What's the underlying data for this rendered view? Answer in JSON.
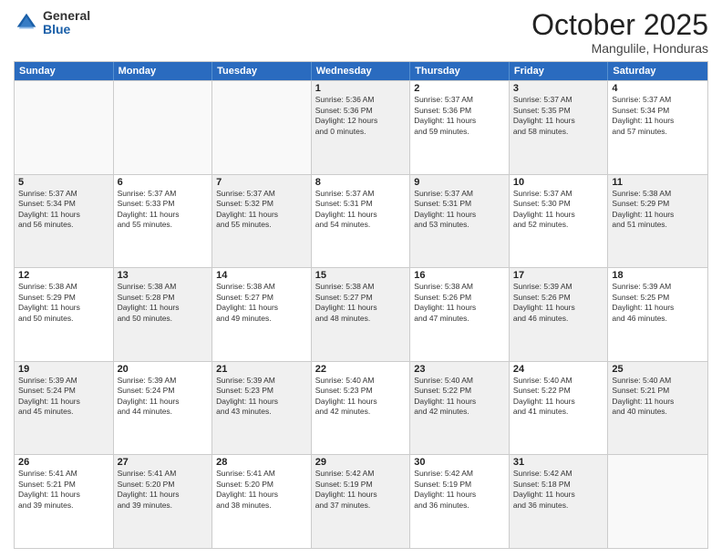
{
  "logo": {
    "general": "General",
    "blue": "Blue"
  },
  "title": "October 2025",
  "location": "Mangulile, Honduras",
  "header_days": [
    "Sunday",
    "Monday",
    "Tuesday",
    "Wednesday",
    "Thursday",
    "Friday",
    "Saturday"
  ],
  "rows": [
    [
      {
        "day": "",
        "info": "",
        "empty": true
      },
      {
        "day": "",
        "info": "",
        "empty": true
      },
      {
        "day": "",
        "info": "",
        "empty": true
      },
      {
        "day": "1",
        "info": "Sunrise: 5:36 AM\nSunset: 5:36 PM\nDaylight: 12 hours\nand 0 minutes."
      },
      {
        "day": "2",
        "info": "Sunrise: 5:37 AM\nSunset: 5:36 PM\nDaylight: 11 hours\nand 59 minutes."
      },
      {
        "day": "3",
        "info": "Sunrise: 5:37 AM\nSunset: 5:35 PM\nDaylight: 11 hours\nand 58 minutes."
      },
      {
        "day": "4",
        "info": "Sunrise: 5:37 AM\nSunset: 5:34 PM\nDaylight: 11 hours\nand 57 minutes."
      }
    ],
    [
      {
        "day": "5",
        "info": "Sunrise: 5:37 AM\nSunset: 5:34 PM\nDaylight: 11 hours\nand 56 minutes."
      },
      {
        "day": "6",
        "info": "Sunrise: 5:37 AM\nSunset: 5:33 PM\nDaylight: 11 hours\nand 55 minutes."
      },
      {
        "day": "7",
        "info": "Sunrise: 5:37 AM\nSunset: 5:32 PM\nDaylight: 11 hours\nand 55 minutes."
      },
      {
        "day": "8",
        "info": "Sunrise: 5:37 AM\nSunset: 5:31 PM\nDaylight: 11 hours\nand 54 minutes."
      },
      {
        "day": "9",
        "info": "Sunrise: 5:37 AM\nSunset: 5:31 PM\nDaylight: 11 hours\nand 53 minutes."
      },
      {
        "day": "10",
        "info": "Sunrise: 5:37 AM\nSunset: 5:30 PM\nDaylight: 11 hours\nand 52 minutes."
      },
      {
        "day": "11",
        "info": "Sunrise: 5:38 AM\nSunset: 5:29 PM\nDaylight: 11 hours\nand 51 minutes."
      }
    ],
    [
      {
        "day": "12",
        "info": "Sunrise: 5:38 AM\nSunset: 5:29 PM\nDaylight: 11 hours\nand 50 minutes."
      },
      {
        "day": "13",
        "info": "Sunrise: 5:38 AM\nSunset: 5:28 PM\nDaylight: 11 hours\nand 50 minutes."
      },
      {
        "day": "14",
        "info": "Sunrise: 5:38 AM\nSunset: 5:27 PM\nDaylight: 11 hours\nand 49 minutes."
      },
      {
        "day": "15",
        "info": "Sunrise: 5:38 AM\nSunset: 5:27 PM\nDaylight: 11 hours\nand 48 minutes."
      },
      {
        "day": "16",
        "info": "Sunrise: 5:38 AM\nSunset: 5:26 PM\nDaylight: 11 hours\nand 47 minutes."
      },
      {
        "day": "17",
        "info": "Sunrise: 5:39 AM\nSunset: 5:26 PM\nDaylight: 11 hours\nand 46 minutes."
      },
      {
        "day": "18",
        "info": "Sunrise: 5:39 AM\nSunset: 5:25 PM\nDaylight: 11 hours\nand 46 minutes."
      }
    ],
    [
      {
        "day": "19",
        "info": "Sunrise: 5:39 AM\nSunset: 5:24 PM\nDaylight: 11 hours\nand 45 minutes."
      },
      {
        "day": "20",
        "info": "Sunrise: 5:39 AM\nSunset: 5:24 PM\nDaylight: 11 hours\nand 44 minutes."
      },
      {
        "day": "21",
        "info": "Sunrise: 5:39 AM\nSunset: 5:23 PM\nDaylight: 11 hours\nand 43 minutes."
      },
      {
        "day": "22",
        "info": "Sunrise: 5:40 AM\nSunset: 5:23 PM\nDaylight: 11 hours\nand 42 minutes."
      },
      {
        "day": "23",
        "info": "Sunrise: 5:40 AM\nSunset: 5:22 PM\nDaylight: 11 hours\nand 42 minutes."
      },
      {
        "day": "24",
        "info": "Sunrise: 5:40 AM\nSunset: 5:22 PM\nDaylight: 11 hours\nand 41 minutes."
      },
      {
        "day": "25",
        "info": "Sunrise: 5:40 AM\nSunset: 5:21 PM\nDaylight: 11 hours\nand 40 minutes."
      }
    ],
    [
      {
        "day": "26",
        "info": "Sunrise: 5:41 AM\nSunset: 5:21 PM\nDaylight: 11 hours\nand 39 minutes."
      },
      {
        "day": "27",
        "info": "Sunrise: 5:41 AM\nSunset: 5:20 PM\nDaylight: 11 hours\nand 39 minutes."
      },
      {
        "day": "28",
        "info": "Sunrise: 5:41 AM\nSunset: 5:20 PM\nDaylight: 11 hours\nand 38 minutes."
      },
      {
        "day": "29",
        "info": "Sunrise: 5:42 AM\nSunset: 5:19 PM\nDaylight: 11 hours\nand 37 minutes."
      },
      {
        "day": "30",
        "info": "Sunrise: 5:42 AM\nSunset: 5:19 PM\nDaylight: 11 hours\nand 36 minutes."
      },
      {
        "day": "31",
        "info": "Sunrise: 5:42 AM\nSunset: 5:18 PM\nDaylight: 11 hours\nand 36 minutes."
      },
      {
        "day": "",
        "info": "",
        "empty": true
      }
    ]
  ]
}
